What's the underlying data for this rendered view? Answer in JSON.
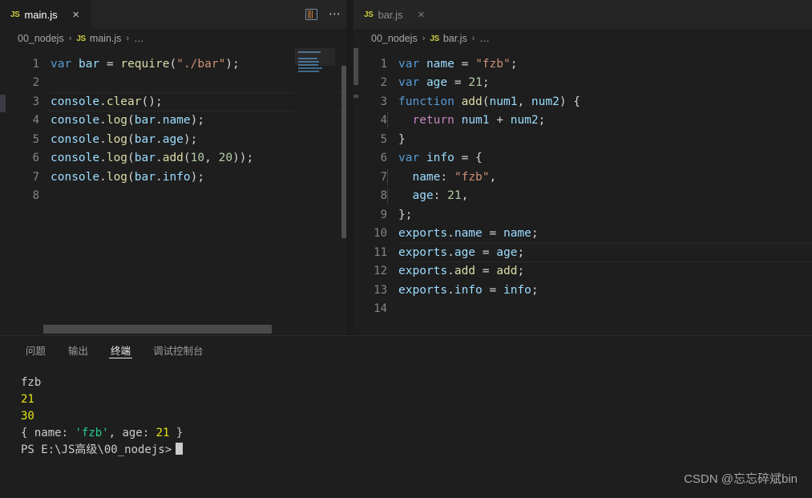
{
  "window": {
    "theme_bg": "#1e1e1e",
    "tabbar_bg": "#252526"
  },
  "editor_left": {
    "tab": {
      "label": "main.js",
      "icon": "js-file-icon",
      "close_glyph": "×",
      "active": true
    },
    "actions": {
      "split_label": "split-editor",
      "more_label": "⋯"
    },
    "breadcrumb": {
      "folder": "00_nodejs",
      "file": "main.js",
      "ellipsis": "…",
      "separator": "›"
    },
    "current_line": 3,
    "lines": [
      {
        "n": "1",
        "tokens": [
          {
            "t": "var",
            "c": "t-kw"
          },
          {
            "t": " ",
            "c": "t-op"
          },
          {
            "t": "bar",
            "c": "t-var"
          },
          {
            "t": " ",
            "c": "t-op"
          },
          {
            "t": "=",
            "c": "t-op"
          },
          {
            "t": " ",
            "c": "t-op"
          },
          {
            "t": "require",
            "c": "t-fn"
          },
          {
            "t": "(",
            "c": "t-op"
          },
          {
            "t": "\"./bar\"",
            "c": "t-str"
          },
          {
            "t": ");",
            "c": "t-op"
          }
        ]
      },
      {
        "n": "2",
        "tokens": []
      },
      {
        "n": "3",
        "tokens": [
          {
            "t": "console",
            "c": "t-var"
          },
          {
            "t": ".",
            "c": "t-op"
          },
          {
            "t": "clear",
            "c": "t-fn"
          },
          {
            "t": "();",
            "c": "t-op"
          }
        ]
      },
      {
        "n": "4",
        "tokens": [
          {
            "t": "console",
            "c": "t-var"
          },
          {
            "t": ".",
            "c": "t-op"
          },
          {
            "t": "log",
            "c": "t-fn"
          },
          {
            "t": "(",
            "c": "t-op"
          },
          {
            "t": "bar",
            "c": "t-var"
          },
          {
            "t": ".",
            "c": "t-op"
          },
          {
            "t": "name",
            "c": "t-prop"
          },
          {
            "t": ");",
            "c": "t-op"
          }
        ]
      },
      {
        "n": "5",
        "tokens": [
          {
            "t": "console",
            "c": "t-var"
          },
          {
            "t": ".",
            "c": "t-op"
          },
          {
            "t": "log",
            "c": "t-fn"
          },
          {
            "t": "(",
            "c": "t-op"
          },
          {
            "t": "bar",
            "c": "t-var"
          },
          {
            "t": ".",
            "c": "t-op"
          },
          {
            "t": "age",
            "c": "t-prop"
          },
          {
            "t": ");",
            "c": "t-op"
          }
        ]
      },
      {
        "n": "6",
        "tokens": [
          {
            "t": "console",
            "c": "t-var"
          },
          {
            "t": ".",
            "c": "t-op"
          },
          {
            "t": "log",
            "c": "t-fn"
          },
          {
            "t": "(",
            "c": "t-op"
          },
          {
            "t": "bar",
            "c": "t-var"
          },
          {
            "t": ".",
            "c": "t-op"
          },
          {
            "t": "add",
            "c": "t-fn"
          },
          {
            "t": "(",
            "c": "t-op"
          },
          {
            "t": "10",
            "c": "t-num"
          },
          {
            "t": ", ",
            "c": "t-op"
          },
          {
            "t": "20",
            "c": "t-num"
          },
          {
            "t": "));",
            "c": "t-op"
          }
        ]
      },
      {
        "n": "7",
        "tokens": [
          {
            "t": "console",
            "c": "t-var"
          },
          {
            "t": ".",
            "c": "t-op"
          },
          {
            "t": "log",
            "c": "t-fn"
          },
          {
            "t": "(",
            "c": "t-op"
          },
          {
            "t": "bar",
            "c": "t-var"
          },
          {
            "t": ".",
            "c": "t-op"
          },
          {
            "t": "info",
            "c": "t-prop"
          },
          {
            "t": ");",
            "c": "t-op"
          }
        ]
      },
      {
        "n": "8",
        "tokens": []
      }
    ]
  },
  "editor_right": {
    "tab": {
      "label": "bar.js",
      "icon": "js-file-icon",
      "close_glyph": "×",
      "active": false
    },
    "breadcrumb": {
      "folder": "00_nodejs",
      "file": "bar.js",
      "ellipsis": "…",
      "separator": "›"
    },
    "current_line": 11,
    "lines": [
      {
        "n": "1",
        "indent": 0,
        "tokens": [
          {
            "t": "var",
            "c": "t-kw"
          },
          {
            "t": " ",
            "c": "t-op"
          },
          {
            "t": "name",
            "c": "t-var"
          },
          {
            "t": " = ",
            "c": "t-op"
          },
          {
            "t": "\"fzb\"",
            "c": "t-str"
          },
          {
            "t": ";",
            "c": "t-op"
          }
        ]
      },
      {
        "n": "2",
        "indent": 0,
        "tokens": [
          {
            "t": "var",
            "c": "t-kw"
          },
          {
            "t": " ",
            "c": "t-op"
          },
          {
            "t": "age",
            "c": "t-var"
          },
          {
            "t": " = ",
            "c": "t-op"
          },
          {
            "t": "21",
            "c": "t-num"
          },
          {
            "t": ";",
            "c": "t-op"
          }
        ]
      },
      {
        "n": "3",
        "indent": 0,
        "tokens": [
          {
            "t": "function",
            "c": "t-kw"
          },
          {
            "t": " ",
            "c": "t-op"
          },
          {
            "t": "add",
            "c": "t-fn"
          },
          {
            "t": "(",
            "c": "t-op"
          },
          {
            "t": "num1",
            "c": "t-var"
          },
          {
            "t": ", ",
            "c": "t-op"
          },
          {
            "t": "num2",
            "c": "t-var"
          },
          {
            "t": ") {",
            "c": "t-op"
          }
        ]
      },
      {
        "n": "4",
        "indent": 1,
        "tokens": [
          {
            "t": "  ",
            "c": "t-op"
          },
          {
            "t": "return",
            "c": "t-kwpink"
          },
          {
            "t": " ",
            "c": "t-op"
          },
          {
            "t": "num1",
            "c": "t-var"
          },
          {
            "t": " + ",
            "c": "t-op"
          },
          {
            "t": "num2",
            "c": "t-var"
          },
          {
            "t": ";",
            "c": "t-op"
          }
        ]
      },
      {
        "n": "5",
        "indent": 0,
        "tokens": [
          {
            "t": "}",
            "c": "t-op"
          }
        ]
      },
      {
        "n": "6",
        "indent": 0,
        "tokens": [
          {
            "t": "var",
            "c": "t-kw"
          },
          {
            "t": " ",
            "c": "t-op"
          },
          {
            "t": "info",
            "c": "t-var"
          },
          {
            "t": " = {",
            "c": "t-op"
          }
        ]
      },
      {
        "n": "7",
        "indent": 1,
        "tokens": [
          {
            "t": "  ",
            "c": "t-op"
          },
          {
            "t": "name",
            "c": "t-var"
          },
          {
            "t": ": ",
            "c": "t-op"
          },
          {
            "t": "\"fzb\"",
            "c": "t-str"
          },
          {
            "t": ",",
            "c": "t-op"
          }
        ]
      },
      {
        "n": "8",
        "indent": 1,
        "tokens": [
          {
            "t": "  ",
            "c": "t-op"
          },
          {
            "t": "age",
            "c": "t-var"
          },
          {
            "t": ": ",
            "c": "t-op"
          },
          {
            "t": "21",
            "c": "t-num"
          },
          {
            "t": ",",
            "c": "t-op"
          }
        ]
      },
      {
        "n": "9",
        "indent": 0,
        "tokens": [
          {
            "t": "};",
            "c": "t-op"
          }
        ]
      },
      {
        "n": "10",
        "indent": 0,
        "tokens": [
          {
            "t": "exports",
            "c": "t-var"
          },
          {
            "t": ".",
            "c": "t-op"
          },
          {
            "t": "name",
            "c": "t-prop"
          },
          {
            "t": " = ",
            "c": "t-op"
          },
          {
            "t": "name",
            "c": "t-var"
          },
          {
            "t": ";",
            "c": "t-op"
          }
        ]
      },
      {
        "n": "11",
        "indent": 0,
        "tokens": [
          {
            "t": "exports",
            "c": "t-var"
          },
          {
            "t": ".",
            "c": "t-op"
          },
          {
            "t": "age",
            "c": "t-prop"
          },
          {
            "t": " = ",
            "c": "t-op"
          },
          {
            "t": "age",
            "c": "t-var"
          },
          {
            "t": ";",
            "c": "t-op"
          }
        ]
      },
      {
        "n": "12",
        "indent": 0,
        "tokens": [
          {
            "t": "exports",
            "c": "t-var"
          },
          {
            "t": ".",
            "c": "t-op"
          },
          {
            "t": "add",
            "c": "t-fn"
          },
          {
            "t": " = ",
            "c": "t-op"
          },
          {
            "t": "add",
            "c": "t-fn"
          },
          {
            "t": ";",
            "c": "t-op"
          }
        ]
      },
      {
        "n": "13",
        "indent": 0,
        "tokens": [
          {
            "t": "exports",
            "c": "t-var"
          },
          {
            "t": ".",
            "c": "t-op"
          },
          {
            "t": "info",
            "c": "t-prop"
          },
          {
            "t": " = ",
            "c": "t-op"
          },
          {
            "t": "info",
            "c": "t-var"
          },
          {
            "t": ";",
            "c": "t-op"
          }
        ]
      },
      {
        "n": "14",
        "indent": 0,
        "tokens": []
      }
    ]
  },
  "panel": {
    "tabs": [
      {
        "label": "问题",
        "active": false
      },
      {
        "label": "输出",
        "active": false
      },
      {
        "label": "终端",
        "active": true
      },
      {
        "label": "调试控制台",
        "active": false
      }
    ],
    "terminal": {
      "lines": [
        [
          {
            "t": "fzb",
            "c": "term-white"
          }
        ],
        [
          {
            "t": "21",
            "c": "term-yellow"
          }
        ],
        [
          {
            "t": "30",
            "c": "term-yellow"
          }
        ],
        [
          {
            "t": "{ name: ",
            "c": "term-white"
          },
          {
            "t": "'fzb'",
            "c": "term-green"
          },
          {
            "t": ", age: ",
            "c": "term-white"
          },
          {
            "t": "21",
            "c": "term-yellow"
          },
          {
            "t": " }",
            "c": "term-white"
          }
        ],
        [
          {
            "t": "PS E:\\JS高级\\00_nodejs>",
            "c": "term-white"
          }
        ]
      ],
      "prompt_cursor": true
    }
  },
  "watermark": {
    "text": "CSDN @忘忘碎斌bin"
  }
}
